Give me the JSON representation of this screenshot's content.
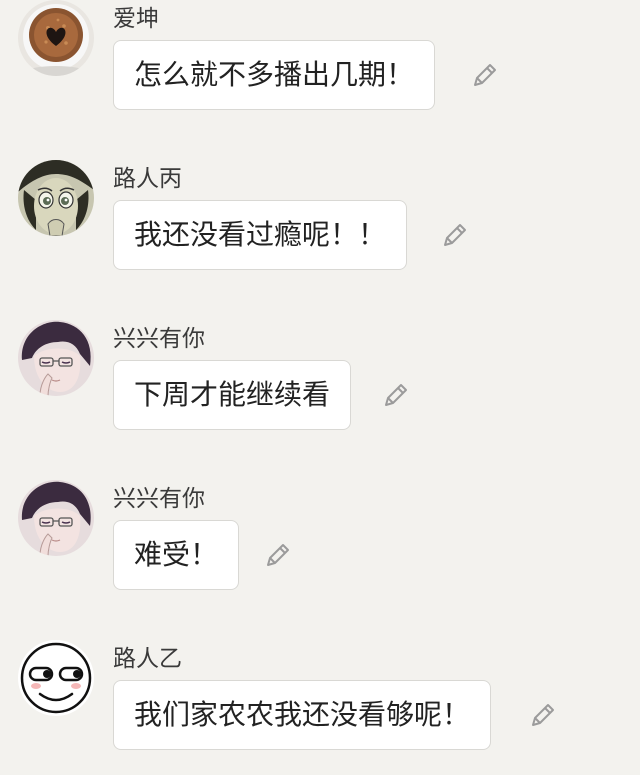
{
  "messages": [
    {
      "author": "爱坤",
      "text": "怎么就不多播出几期！",
      "avatar_icon": "coffee-heart-avatar"
    },
    {
      "author": "路人丙",
      "text": "我还没看过瘾呢！！",
      "avatar_icon": "crying-cartoon-face-avatar"
    },
    {
      "author": "兴兴有你",
      "text": "下周才能继续看",
      "avatar_icon": "anime-boy-glasses-avatar"
    },
    {
      "author": "兴兴有你",
      "text": "难受！",
      "avatar_icon": "anime-boy-glasses-avatar"
    },
    {
      "author": "路人乙",
      "text": "我们家农农我还没看够呢！",
      "avatar_icon": "smirk-emoji-face-avatar"
    }
  ],
  "colors": {
    "background": "#f3f2ee",
    "bubble": "#ffffff",
    "bubble_border": "#d9d8d4",
    "edit_icon": "#9b9b9b"
  },
  "edit_icon": "pencil-icon"
}
